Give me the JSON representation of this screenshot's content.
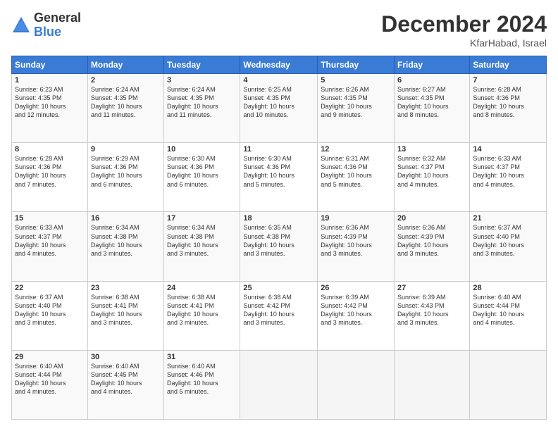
{
  "logo": {
    "general": "General",
    "blue": "Blue"
  },
  "title": "December 2024",
  "location": "KfarHabad, Israel",
  "days_header": [
    "Sunday",
    "Monday",
    "Tuesday",
    "Wednesday",
    "Thursday",
    "Friday",
    "Saturday"
  ],
  "weeks": [
    [
      {
        "day": "1",
        "info": "Sunrise: 6:23 AM\nSunset: 4:35 PM\nDaylight: 10 hours\nand 12 minutes."
      },
      {
        "day": "2",
        "info": "Sunrise: 6:24 AM\nSunset: 4:35 PM\nDaylight: 10 hours\nand 11 minutes."
      },
      {
        "day": "3",
        "info": "Sunrise: 6:24 AM\nSunset: 4:35 PM\nDaylight: 10 hours\nand 11 minutes."
      },
      {
        "day": "4",
        "info": "Sunrise: 6:25 AM\nSunset: 4:35 PM\nDaylight: 10 hours\nand 10 minutes."
      },
      {
        "day": "5",
        "info": "Sunrise: 6:26 AM\nSunset: 4:35 PM\nDaylight: 10 hours\nand 9 minutes."
      },
      {
        "day": "6",
        "info": "Sunrise: 6:27 AM\nSunset: 4:35 PM\nDaylight: 10 hours\nand 8 minutes."
      },
      {
        "day": "7",
        "info": "Sunrise: 6:28 AM\nSunset: 4:36 PM\nDaylight: 10 hours\nand 8 minutes."
      }
    ],
    [
      {
        "day": "8",
        "info": "Sunrise: 6:28 AM\nSunset: 4:36 PM\nDaylight: 10 hours\nand 7 minutes."
      },
      {
        "day": "9",
        "info": "Sunrise: 6:29 AM\nSunset: 4:36 PM\nDaylight: 10 hours\nand 6 minutes."
      },
      {
        "day": "10",
        "info": "Sunrise: 6:30 AM\nSunset: 4:36 PM\nDaylight: 10 hours\nand 6 minutes."
      },
      {
        "day": "11",
        "info": "Sunrise: 6:30 AM\nSunset: 4:36 PM\nDaylight: 10 hours\nand 5 minutes."
      },
      {
        "day": "12",
        "info": "Sunrise: 6:31 AM\nSunset: 4:36 PM\nDaylight: 10 hours\nand 5 minutes."
      },
      {
        "day": "13",
        "info": "Sunrise: 6:32 AM\nSunset: 4:37 PM\nDaylight: 10 hours\nand 4 minutes."
      },
      {
        "day": "14",
        "info": "Sunrise: 6:33 AM\nSunset: 4:37 PM\nDaylight: 10 hours\nand 4 minutes."
      }
    ],
    [
      {
        "day": "15",
        "info": "Sunrise: 6:33 AM\nSunset: 4:37 PM\nDaylight: 10 hours\nand 4 minutes."
      },
      {
        "day": "16",
        "info": "Sunrise: 6:34 AM\nSunset: 4:38 PM\nDaylight: 10 hours\nand 3 minutes."
      },
      {
        "day": "17",
        "info": "Sunrise: 6:34 AM\nSunset: 4:38 PM\nDaylight: 10 hours\nand 3 minutes."
      },
      {
        "day": "18",
        "info": "Sunrise: 6:35 AM\nSunset: 4:38 PM\nDaylight: 10 hours\nand 3 minutes."
      },
      {
        "day": "19",
        "info": "Sunrise: 6:36 AM\nSunset: 4:39 PM\nDaylight: 10 hours\nand 3 minutes."
      },
      {
        "day": "20",
        "info": "Sunrise: 6:36 AM\nSunset: 4:39 PM\nDaylight: 10 hours\nand 3 minutes."
      },
      {
        "day": "21",
        "info": "Sunrise: 6:37 AM\nSunset: 4:40 PM\nDaylight: 10 hours\nand 3 minutes."
      }
    ],
    [
      {
        "day": "22",
        "info": "Sunrise: 6:37 AM\nSunset: 4:40 PM\nDaylight: 10 hours\nand 3 minutes."
      },
      {
        "day": "23",
        "info": "Sunrise: 6:38 AM\nSunset: 4:41 PM\nDaylight: 10 hours\nand 3 minutes."
      },
      {
        "day": "24",
        "info": "Sunrise: 6:38 AM\nSunset: 4:41 PM\nDaylight: 10 hours\nand 3 minutes."
      },
      {
        "day": "25",
        "info": "Sunrise: 6:38 AM\nSunset: 4:42 PM\nDaylight: 10 hours\nand 3 minutes."
      },
      {
        "day": "26",
        "info": "Sunrise: 6:39 AM\nSunset: 4:42 PM\nDaylight: 10 hours\nand 3 minutes."
      },
      {
        "day": "27",
        "info": "Sunrise: 6:39 AM\nSunset: 4:43 PM\nDaylight: 10 hours\nand 3 minutes."
      },
      {
        "day": "28",
        "info": "Sunrise: 6:40 AM\nSunset: 4:44 PM\nDaylight: 10 hours\nand 4 minutes."
      }
    ],
    [
      {
        "day": "29",
        "info": "Sunrise: 6:40 AM\nSunset: 4:44 PM\nDaylight: 10 hours\nand 4 minutes."
      },
      {
        "day": "30",
        "info": "Sunrise: 6:40 AM\nSunset: 4:45 PM\nDaylight: 10 hours\nand 4 minutes."
      },
      {
        "day": "31",
        "info": "Sunrise: 6:40 AM\nSunset: 4:46 PM\nDaylight: 10 hours\nand 5 minutes."
      },
      {
        "day": "",
        "info": ""
      },
      {
        "day": "",
        "info": ""
      },
      {
        "day": "",
        "info": ""
      },
      {
        "day": "",
        "info": ""
      }
    ]
  ]
}
